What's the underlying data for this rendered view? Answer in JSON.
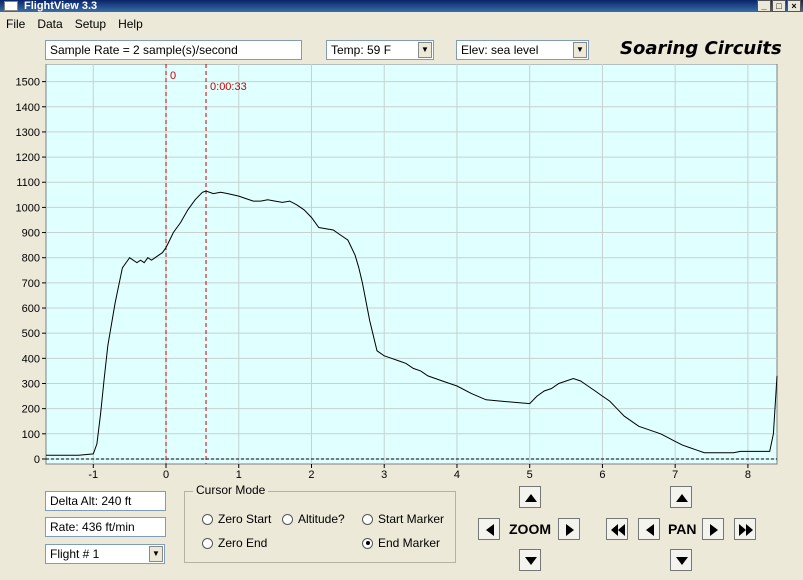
{
  "window": {
    "title": "FlightView 3.3"
  },
  "menu": {
    "items": [
      "File",
      "Data",
      "Setup",
      "Help"
    ]
  },
  "toolbar": {
    "sample_rate": "Sample Rate =  2 sample(s)/second",
    "temp": "Temp:  59 F",
    "elev": "Elev: sea level",
    "brand": "Soaring Circuits"
  },
  "chart_data": {
    "type": "line",
    "x_ticks": [
      -1,
      0,
      1,
      2,
      3,
      4,
      5,
      6,
      7,
      8
    ],
    "y_ticks": [
      0,
      100,
      200,
      300,
      400,
      500,
      600,
      700,
      800,
      900,
      1000,
      1100,
      1200,
      1300,
      1400,
      1500
    ],
    "xlim": [
      -1.65,
      8.4
    ],
    "ylim": [
      -20,
      1570
    ],
    "background": "#e0ffff",
    "line_color": "#000000",
    "marker_color": "#cc0000",
    "markers": [
      {
        "x": 0,
        "label": "0"
      },
      {
        "x": 0.55,
        "label": "0:00:33"
      }
    ],
    "x": [
      -1.65,
      -1.2,
      -1.0,
      -0.95,
      -0.9,
      -0.85,
      -0.8,
      -0.7,
      -0.6,
      -0.5,
      -0.4,
      -0.35,
      -0.3,
      -0.25,
      -0.2,
      -0.15,
      -0.1,
      -0.05,
      0.0,
      0.05,
      0.1,
      0.2,
      0.3,
      0.4,
      0.5,
      0.55,
      0.65,
      0.75,
      0.85,
      1.0,
      1.1,
      1.2,
      1.3,
      1.4,
      1.5,
      1.6,
      1.7,
      1.8,
      1.9,
      2.0,
      2.1,
      2.2,
      2.3,
      2.4,
      2.5,
      2.6,
      2.65,
      2.7,
      2.8,
      2.9,
      3.0,
      3.1,
      3.2,
      3.3,
      3.4,
      3.5,
      3.6,
      3.8,
      4.0,
      4.2,
      4.4,
      4.6,
      4.8,
      5.0,
      5.1,
      5.2,
      5.3,
      5.4,
      5.5,
      5.6,
      5.7,
      5.8,
      5.9,
      6.0,
      6.1,
      6.2,
      6.3,
      6.4,
      6.5,
      6.6,
      6.7,
      6.8,
      6.9,
      7.0,
      7.1,
      7.2,
      7.3,
      7.4,
      7.6,
      7.8,
      7.9,
      8.0,
      8.1,
      8.2,
      8.3,
      8.35,
      8.4
    ],
    "y": [
      15,
      15,
      20,
      60,
      180,
      320,
      450,
      620,
      760,
      800,
      780,
      790,
      780,
      800,
      790,
      800,
      810,
      820,
      840,
      870,
      900,
      940,
      990,
      1030,
      1060,
      1065,
      1055,
      1060,
      1055,
      1045,
      1035,
      1025,
      1025,
      1030,
      1025,
      1020,
      1025,
      1010,
      990,
      960,
      920,
      915,
      910,
      890,
      870,
      810,
      760,
      700,
      550,
      430,
      410,
      400,
      390,
      380,
      360,
      350,
      330,
      310,
      290,
      260,
      235,
      230,
      225,
      220,
      250,
      270,
      280,
      300,
      310,
      320,
      310,
      290,
      270,
      250,
      230,
      200,
      170,
      150,
      130,
      120,
      110,
      100,
      85,
      70,
      55,
      45,
      35,
      25,
      25,
      25,
      30,
      30,
      30,
      30,
      30,
      100,
      330
    ]
  },
  "status": {
    "delta_alt": "Delta Alt: 240 ft",
    "rate": "Rate: 436 ft/min",
    "flight": "Flight # 1"
  },
  "cursor_mode": {
    "title": "Cursor Mode",
    "options": [
      "Zero Start",
      "Altitude?",
      "Start Marker",
      "Zero End",
      "End Marker"
    ],
    "selected": "End Marker"
  },
  "controls": {
    "zoom_label": "ZOOM",
    "pan_label": "PAN"
  }
}
